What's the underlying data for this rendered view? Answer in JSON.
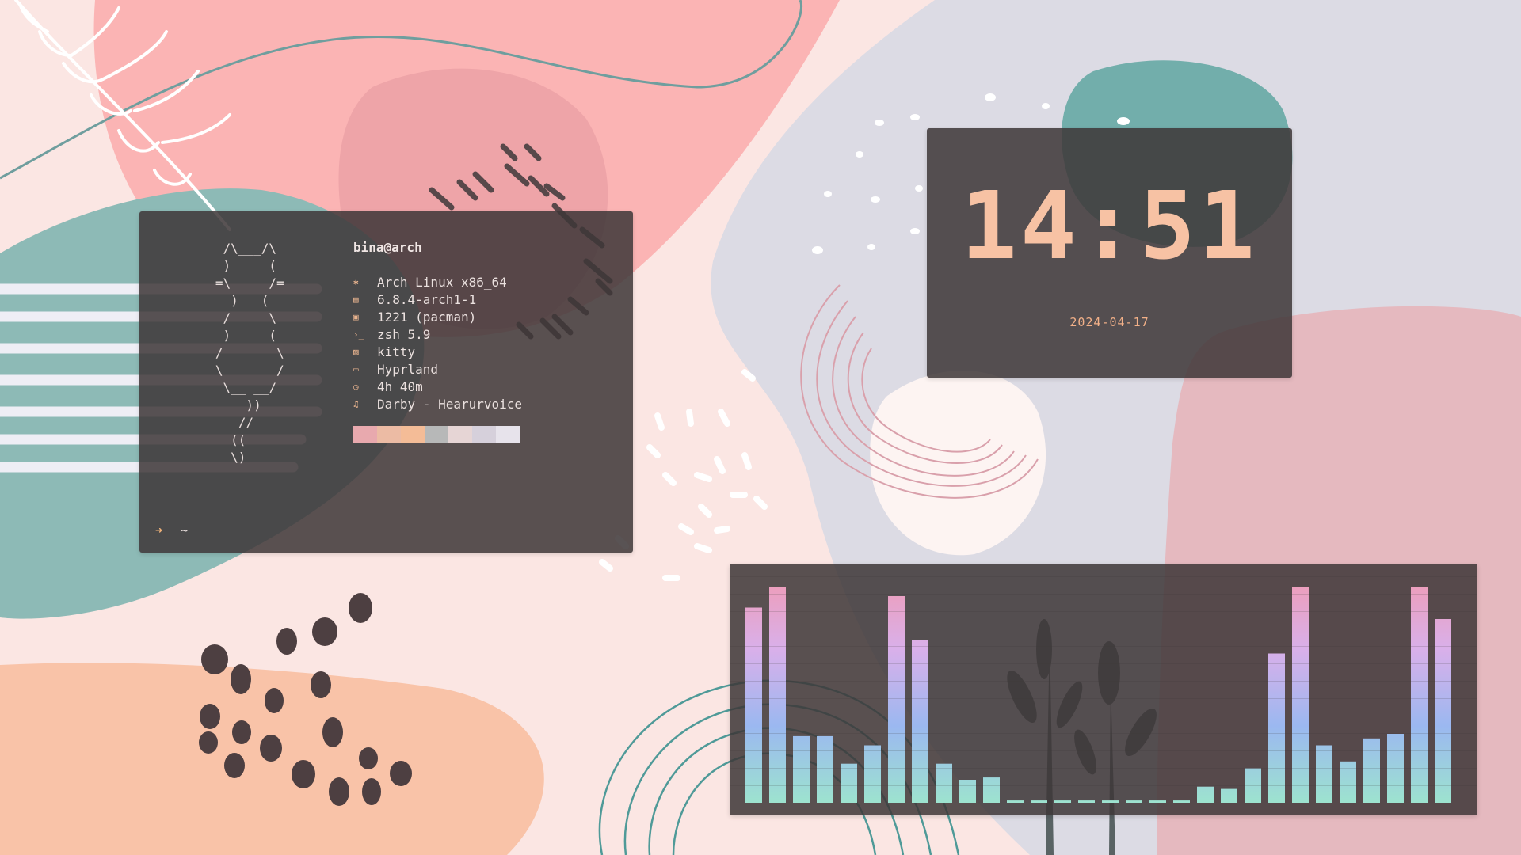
{
  "terminal": {
    "ascii_logo": "    /\\___/\\\n    )     (\n   =\\     /=\n     )   (\n    /     \\\n    )     (\n   /       \\\n   \\       /\n    \\__ __/\n       ))\n      //\n     ((\n     \\)",
    "user_host": "bina@arch",
    "info": [
      {
        "icon": "gear-icon",
        "glyph": "✱",
        "value": "Arch Linux x86_64"
      },
      {
        "icon": "chip-icon",
        "glyph": "▤",
        "value": "6.8.4-arch1-1"
      },
      {
        "icon": "package-icon",
        "glyph": "▣",
        "value": "1221 (pacman)"
      },
      {
        "icon": "shell-prompt-icon",
        "glyph": "›_",
        "value": "zsh 5.9"
      },
      {
        "icon": "terminal-icon",
        "glyph": "▨",
        "value": "kitty"
      },
      {
        "icon": "window-icon",
        "glyph": "▭",
        "value": "Hyprland"
      },
      {
        "icon": "clock-icon",
        "glyph": "◷",
        "value": "4h 40m"
      },
      {
        "icon": "music-note-icon",
        "glyph": "♫",
        "value": "Darby - Hearurvoice"
      }
    ],
    "palette": [
      "#e8a9ae",
      "#ecbba4",
      "#f4bc97",
      "#b7b8b8",
      "#e6d5d5",
      "#d6d0db",
      "#e7e3eb"
    ],
    "prompt_symbol": "➜",
    "prompt_path": "~"
  },
  "clock": {
    "time": "14:51",
    "date": "2024-04-17",
    "color": "#f7c2a4"
  },
  "visualizer": {
    "levels": [
      0.85,
      0.94,
      0.29,
      0.29,
      0.17,
      0.25,
      0.9,
      0.71,
      0.17,
      0.1,
      0.11,
      0.01,
      0.01,
      0.01,
      0.01,
      0.01,
      0.01,
      0.01,
      0.01,
      0.07,
      0.06,
      0.15,
      0.65,
      0.94,
      0.25,
      0.18,
      0.28,
      0.3,
      0.94,
      0.8
    ],
    "gradient": [
      "#9de3cf",
      "#9bb8f0",
      "#d9b0ea",
      "#f09bb4"
    ]
  }
}
